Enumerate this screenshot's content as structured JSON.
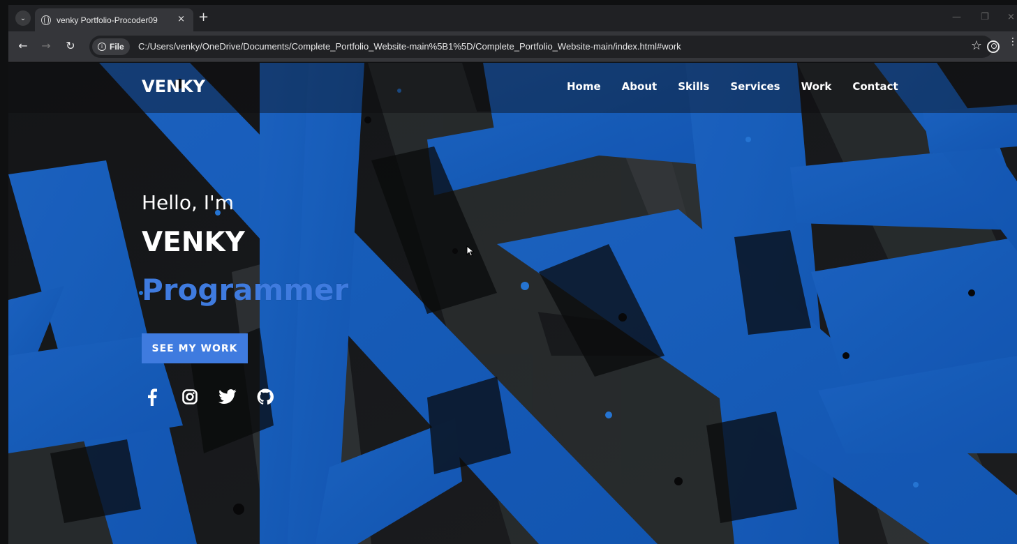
{
  "browser": {
    "tab_title": "venky Portfolio-Procoder09",
    "close_symbol": "×",
    "new_tab_symbol": "+",
    "url_chip": "File",
    "url": "C:/Users/venky/OneDrive/Documents/Complete_Portfolio_Website-main%5B1%5D/Complete_Portfolio_Website-main/index.html#work"
  },
  "site": {
    "logo": "VENKY",
    "nav": [
      "Home",
      "About",
      "Skills",
      "Services",
      "Work",
      "Contact"
    ],
    "hero": {
      "greeting": "Hello, I'm",
      "name": "VENKY",
      "role": "Programmer",
      "cta": "SEE MY WORK"
    },
    "socials": [
      "facebook-icon",
      "instagram-icon",
      "twitter-icon",
      "github-icon"
    ]
  },
  "colors": {
    "accent": "#3f7bdf",
    "background": "#111214",
    "browser_chrome": "#35363a"
  }
}
